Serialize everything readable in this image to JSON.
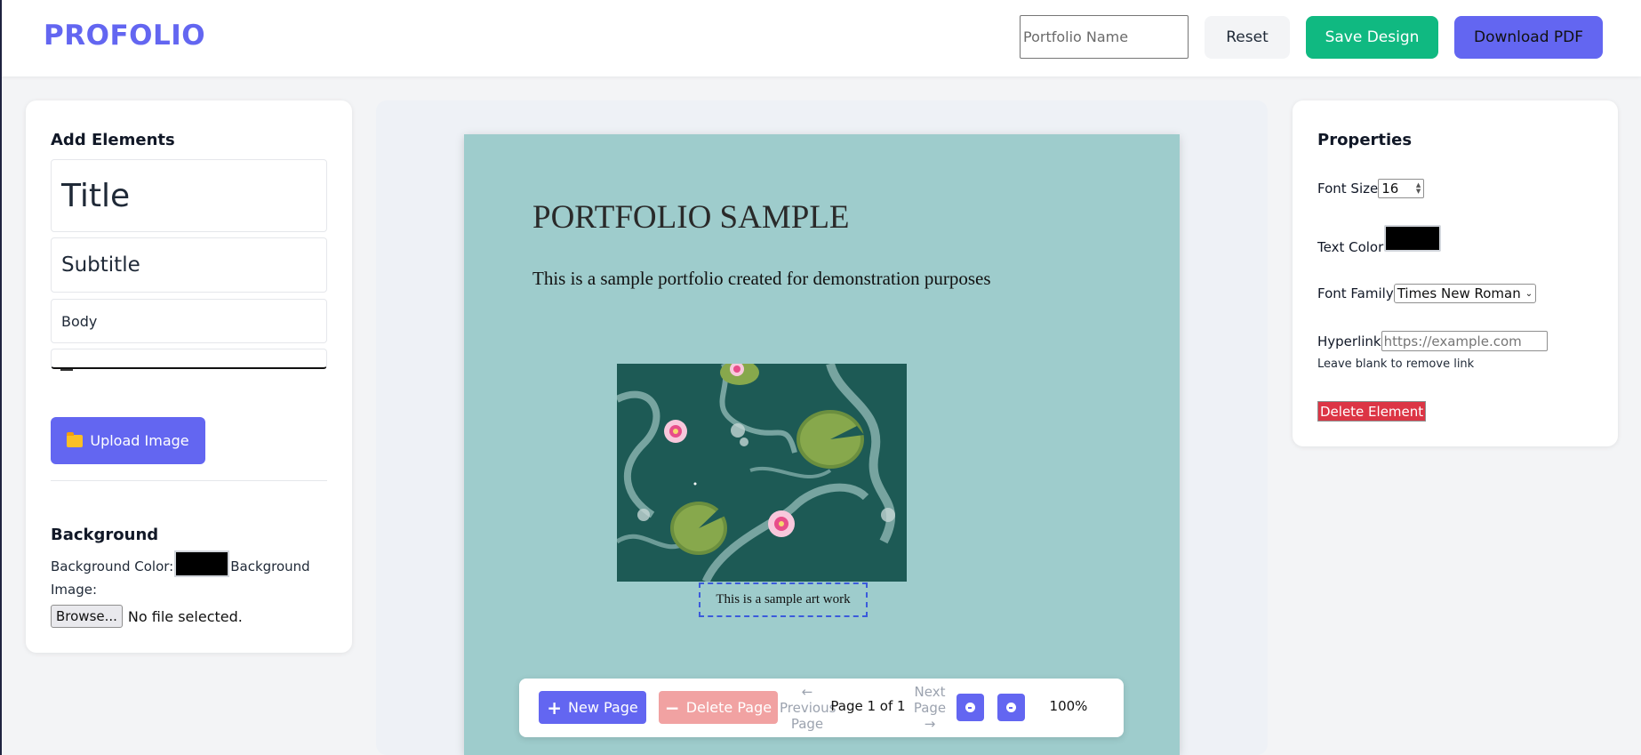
{
  "app": {
    "logo": "PROFOLIO"
  },
  "header": {
    "portfolio_name_placeholder": "Portfolio Name",
    "portfolio_name_value": "",
    "reset_label": "Reset",
    "save_label": "Save Design",
    "download_label": "Download PDF"
  },
  "left_panel": {
    "heading": "Add Elements",
    "elements": {
      "title": "Title",
      "subtitle": "Subtitle",
      "body": "Body"
    },
    "upload_label": "Upload Image",
    "background_heading": "Background",
    "background_color_label": "Background Color:",
    "background_color_value": "#000000",
    "background_image_label": "Background Image:",
    "browse_label": "Browse...",
    "no_file_text": "No file selected."
  },
  "canvas": {
    "background_color": "#9ecccc",
    "title": "PORTFOLIO SAMPLE",
    "body": "This is a sample portfolio created for demonstration purposes",
    "image_alt": "Painting of lily pads and lotus flowers on teal water",
    "caption": "This is a sample art work"
  },
  "page_toolbar": {
    "new_page_label": "New Page",
    "delete_page_label": "Delete Page",
    "previous_label": "Previous Page",
    "previous_arrow": "←",
    "next_label": "Next Page",
    "next_arrow": "→",
    "page_info": "Page 1 of 1",
    "zoom_level": "100%"
  },
  "properties": {
    "heading": "Properties",
    "font_size_label": "Font Size",
    "font_size_value": "16",
    "text_color_label": "Text Color",
    "text_color_value": "#000000",
    "font_family_label": "Font Family",
    "font_family_value": "Times New Roman",
    "hyperlink_label": "Hyperlink",
    "hyperlink_placeholder": "https://example.com",
    "hyperlink_hint": "Leave blank to remove link",
    "delete_element_label": "Delete Element"
  },
  "colors": {
    "accent": "#6366f1",
    "save_green": "#10b981",
    "delete_red": "#dc3545",
    "delete_page_disabled": "#f1a2a2"
  }
}
